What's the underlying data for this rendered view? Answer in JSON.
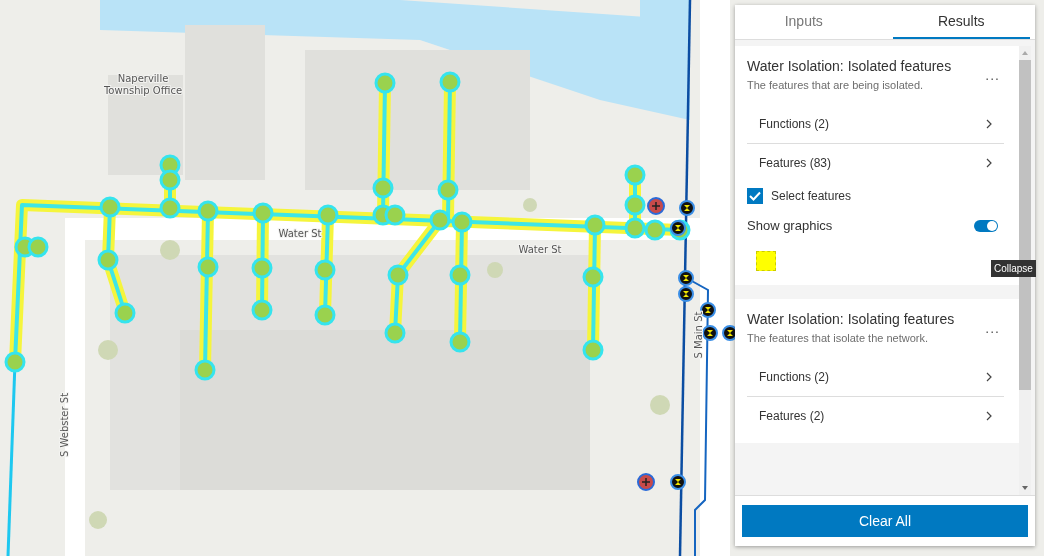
{
  "map": {
    "labels": [
      {
        "kind": "place",
        "lines": [
          "Naperville",
          "Township Office"
        ]
      },
      {
        "kind": "street",
        "lines": [
          "Water St"
        ]
      },
      {
        "kind": "street",
        "lines": [
          "Water St"
        ]
      },
      {
        "kind": "street-vertical",
        "lines": [
          "S Webster St"
        ]
      },
      {
        "kind": "street-vertical",
        "lines": [
          "S Main St"
        ]
      }
    ]
  },
  "panel": {
    "tabs": [
      {
        "label": "Inputs",
        "selected": false
      },
      {
        "label": "Results",
        "selected": true
      }
    ],
    "sections": [
      {
        "title": "Water Isolation: Isolated features",
        "description": "The features that are being isolated.",
        "menu": "...",
        "items": [
          {
            "label": "Functions (2)"
          },
          {
            "label": "Features (83)"
          }
        ],
        "select_features": {
          "label": "Select features",
          "checked": true
        },
        "show_graphics": {
          "label": "Show graphics",
          "on": true,
          "tooltip": "Collapse"
        }
      },
      {
        "title": "Water Isolation: Isolating features",
        "description": "The features that isolate the network.",
        "menu": "...",
        "items": [
          {
            "label": "Functions (2)"
          },
          {
            "label": "Features (2)"
          }
        ]
      }
    ],
    "clear_button": "Clear All"
  }
}
